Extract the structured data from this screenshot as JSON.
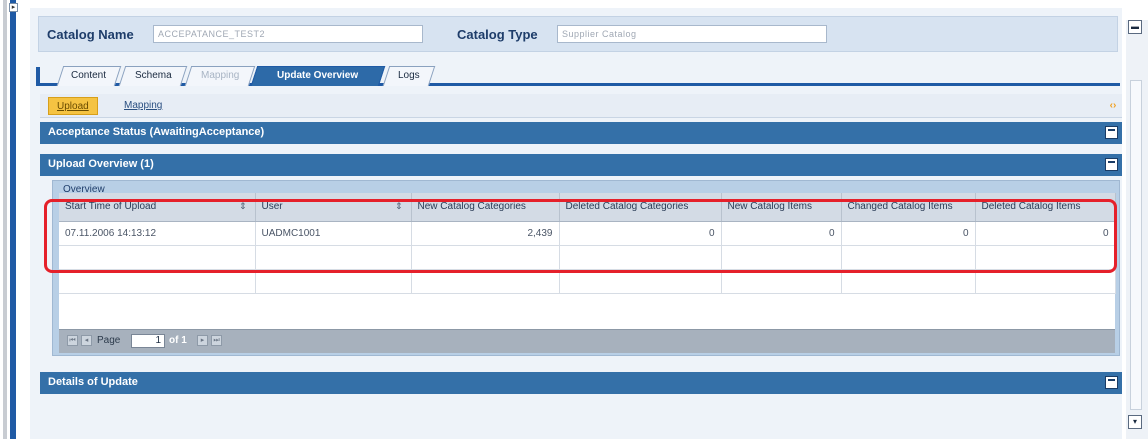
{
  "header": {
    "catalog_name_label": "Catalog Name",
    "catalog_name_value": "ACCEPATANCE_TEST2",
    "catalog_type_label": "Catalog Type",
    "catalog_type_value": "Supplier Catalog"
  },
  "tabs": [
    {
      "label": "Content",
      "state": "normal"
    },
    {
      "label": "Schema",
      "state": "normal"
    },
    {
      "label": "Mapping",
      "state": "disabled"
    },
    {
      "label": "Update Overview",
      "state": "active"
    },
    {
      "label": "Logs",
      "state": "normal"
    }
  ],
  "subtabs": [
    {
      "label": "Upload",
      "state": "active"
    },
    {
      "label": "Mapping",
      "state": "normal"
    }
  ],
  "sections": {
    "acceptance": "Acceptance Status (AwaitingAcceptance)",
    "upload_overview": "Upload Overview (1)",
    "details": "Details of Update"
  },
  "overview": {
    "title": "Overview",
    "columns": [
      "Start Time of Upload",
      "User",
      "New Catalog Categories",
      "Deleted Catalog Categories",
      "New Catalog Items",
      "Changed Catalog Items",
      "Deleted Catalog Items"
    ],
    "rows": [
      [
        "07.11.2006 14:13:12",
        "UADMC1001",
        "2,439",
        "0",
        "0",
        "0",
        "0"
      ]
    ],
    "pager": {
      "label": "Page",
      "page": "1",
      "of": "of 1"
    }
  },
  "colors": {
    "section_blue": "#3470a8",
    "tab_active": "#2d6aa8",
    "highlight_red": "#e5202a",
    "subtab_active": "#f5c342"
  }
}
